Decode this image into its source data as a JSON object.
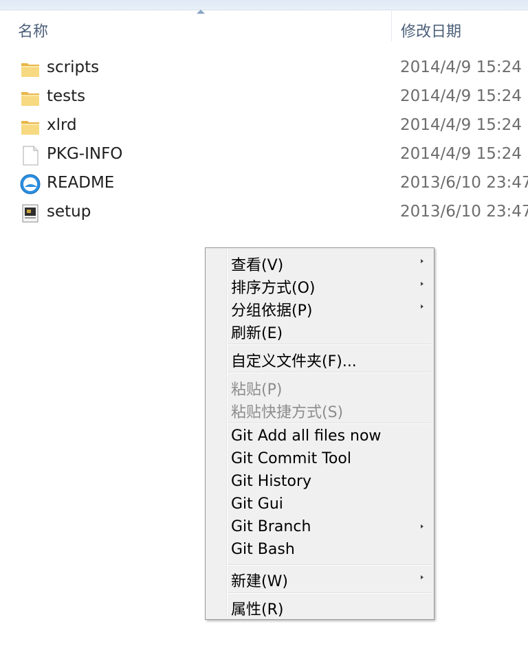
{
  "columns": {
    "name": "名称",
    "date": "修改日期"
  },
  "files": [
    {
      "name": "scripts",
      "date": "2014/4/9 15:24",
      "icon": "folder-icon"
    },
    {
      "name": "tests",
      "date": "2014/4/9 15:24",
      "icon": "folder-icon"
    },
    {
      "name": "xlrd",
      "date": "2014/4/9 15:24",
      "icon": "folder-icon"
    },
    {
      "name": "PKG-INFO",
      "date": "2014/4/9 15:24",
      "icon": "blank-file-icon"
    },
    {
      "name": "README",
      "date": "2013/6/10 23:47",
      "icon": "browser-file-icon"
    },
    {
      "name": "setup",
      "date": "2013/6/10 23:47",
      "icon": "script-file-icon"
    }
  ],
  "context_menu": {
    "items": [
      {
        "label": "查看(V)",
        "submenu": true,
        "disabled": false
      },
      {
        "label": "排序方式(O)",
        "submenu": true,
        "disabled": false
      },
      {
        "label": "分组依据(P)",
        "submenu": true,
        "disabled": false
      },
      {
        "label": "刷新(E)",
        "submenu": false,
        "disabled": false
      },
      {
        "label": "自定义文件夹(F)...",
        "submenu": false,
        "disabled": false
      },
      {
        "label": "粘贴(P)",
        "submenu": false,
        "disabled": true
      },
      {
        "label": "粘贴快捷方式(S)",
        "submenu": false,
        "disabled": true
      },
      {
        "label": "Git Add all files now",
        "submenu": false,
        "disabled": false
      },
      {
        "label": "Git Commit Tool",
        "submenu": false,
        "disabled": false
      },
      {
        "label": "Git History",
        "submenu": false,
        "disabled": false
      },
      {
        "label": "Git Gui",
        "submenu": false,
        "disabled": false
      },
      {
        "label": "Git Branch",
        "submenu": true,
        "disabled": false
      },
      {
        "label": "Git Bash",
        "submenu": false,
        "disabled": false
      },
      {
        "label": "新建(W)",
        "submenu": true,
        "disabled": false
      },
      {
        "label": "属性(R)",
        "submenu": false,
        "disabled": false
      }
    ]
  },
  "colors": {
    "header_text": "#4c607a",
    "date_text": "#6d6d6d",
    "menu_bg": "#f0f0f0",
    "disabled_text": "#8d8d8d"
  }
}
